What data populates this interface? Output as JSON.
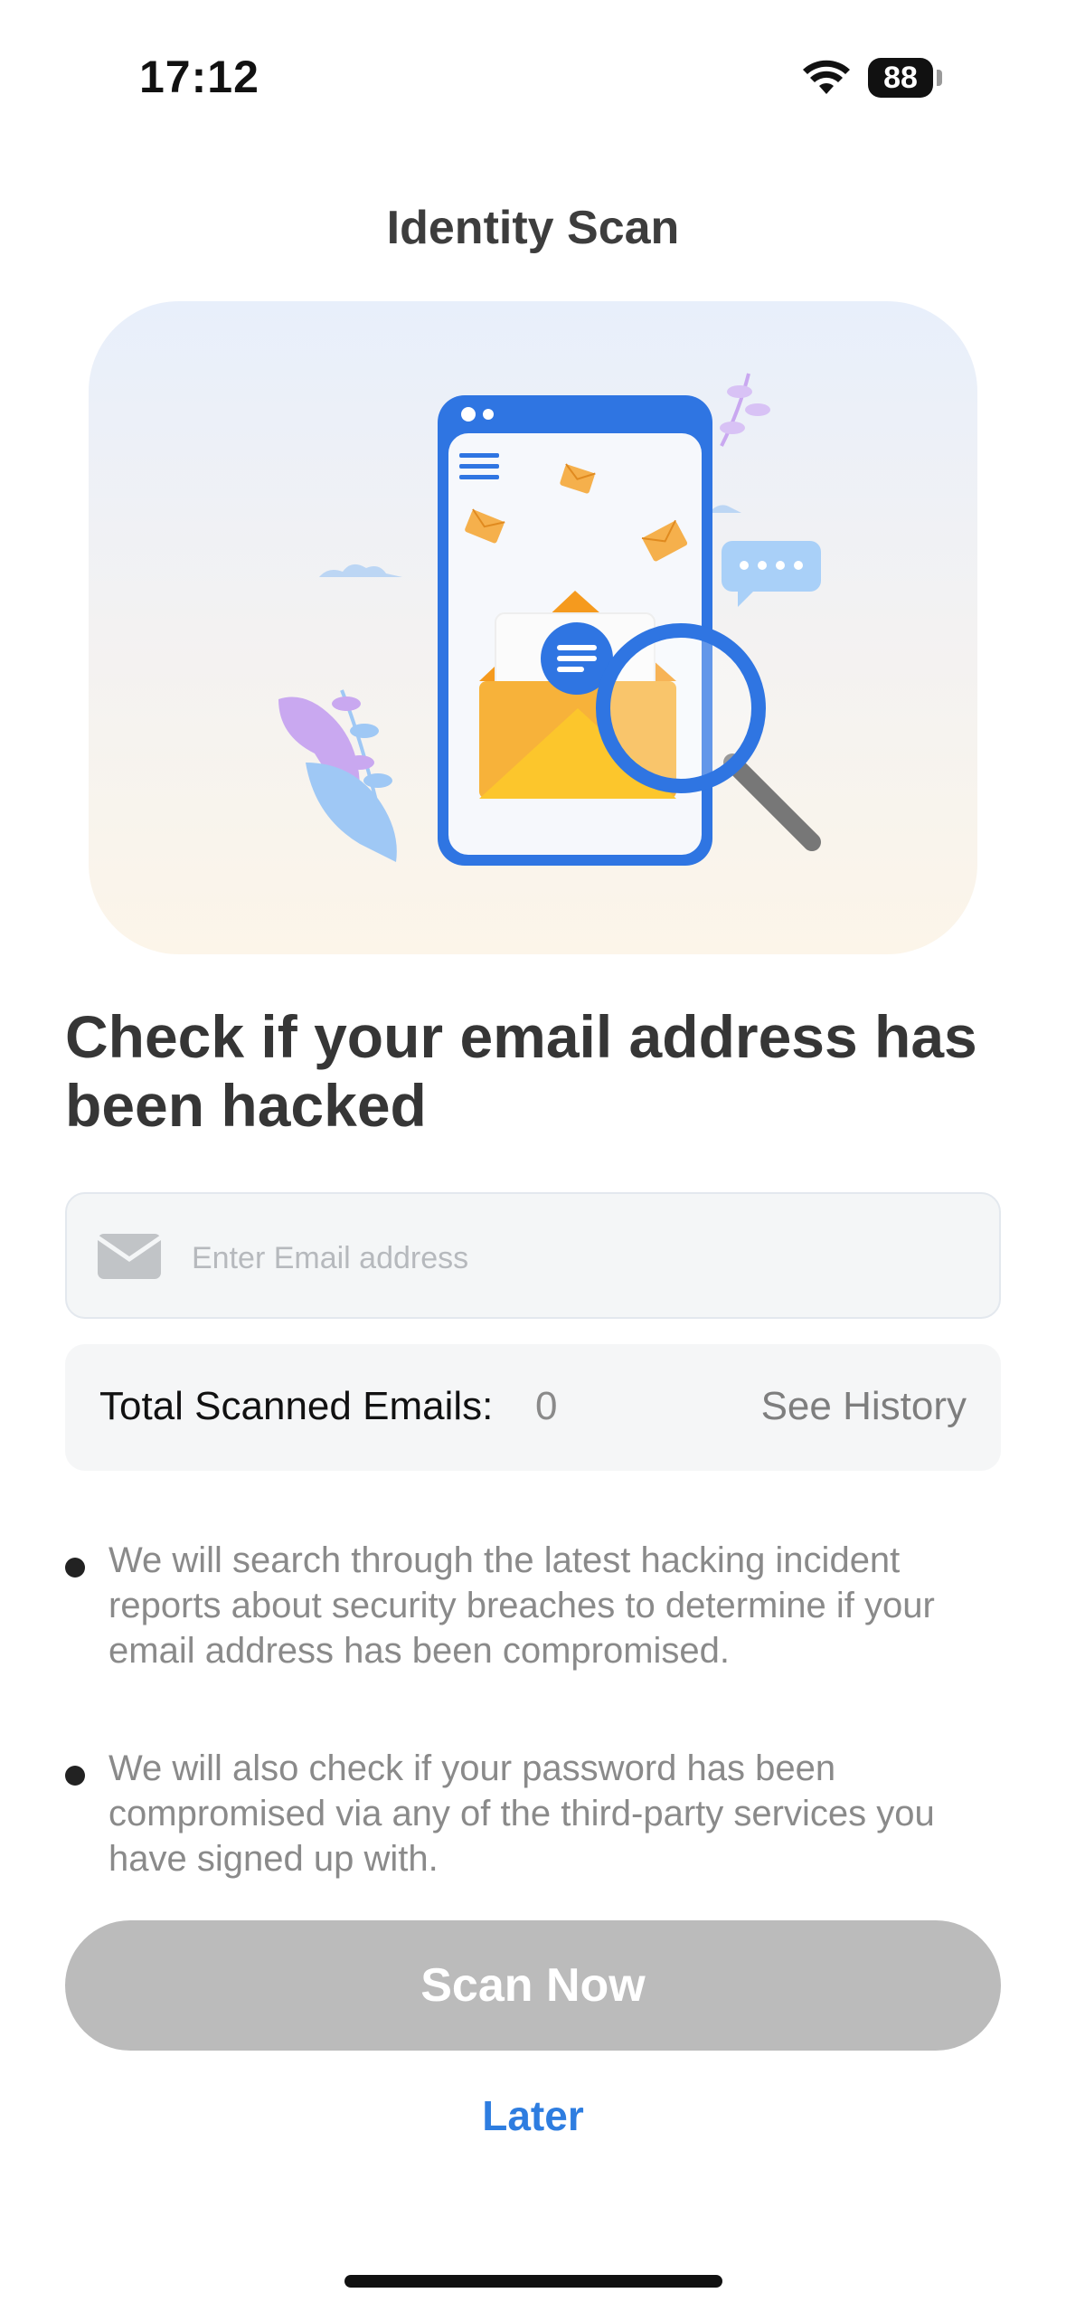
{
  "status_bar": {
    "time": "17:12",
    "battery": "88"
  },
  "nav": {
    "title": "Identity Scan"
  },
  "hero": {
    "illustration": "email-security-illustration"
  },
  "headline": "Check if your email address has been hacked",
  "email": {
    "placeholder": "Enter Email address",
    "value": ""
  },
  "scan_stats": {
    "label": "Total Scanned Emails:",
    "count": "0",
    "history_link": "See History"
  },
  "bullets": [
    "We will search through the latest hacking incident reports about security breaches to determine if your email address has been compromised.",
    "We will also check if your password has been compromised via any of the third-party services you have signed up with."
  ],
  "actions": {
    "scan_now": "Scan Now",
    "later": "Later"
  },
  "colors": {
    "accent": "#2e7de0",
    "button_disabled": "#bbbbbb"
  }
}
